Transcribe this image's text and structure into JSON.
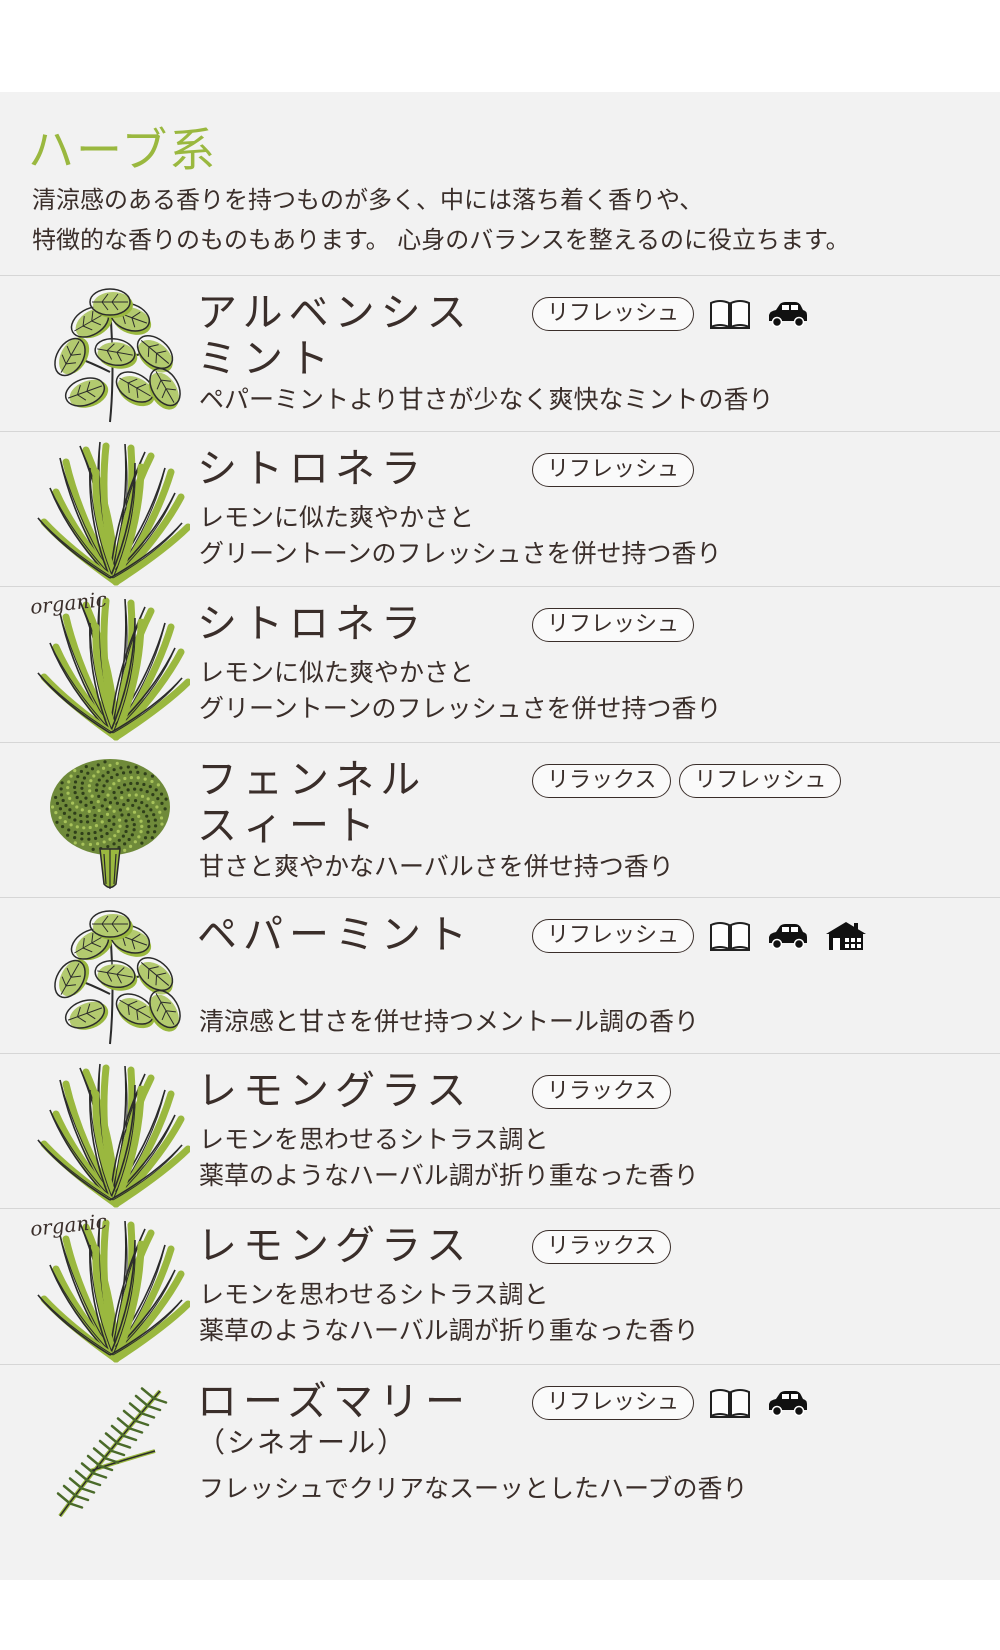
{
  "section": {
    "title": "ハーブ系",
    "description_line1": "清涼感のある香りを持つものが多く、中には落ち着く香りや、",
    "description_line2": "特徴的な香りのものもあります。 心身のバランスを整えるのに役立ちます。"
  },
  "colors": {
    "accent": "#9ab83f",
    "text": "#3a2e2a",
    "panel": "#f2f2f2"
  },
  "items": [
    {
      "name": "アルベンシス\nミント",
      "description": "ペパーミントより甘さが少なく爽快なミントの香り",
      "tags": [
        "リフレッシュ"
      ],
      "icons": [
        "book-icon",
        "car-icon"
      ],
      "organic": "",
      "image": "mint-illustration"
    },
    {
      "name": "シトロネラ",
      "description": "レモンに似た爽やかさと\nグリーントーンのフレッシュさを併せ持つ香り",
      "tags": [
        "リフレッシュ"
      ],
      "icons": [],
      "organic": "",
      "image": "grass-illustration"
    },
    {
      "name": "シトロネラ",
      "description": "レモンに似た爽やかさと\nグリーントーンのフレッシュさを併せ持つ香り",
      "tags": [
        "リフレッシュ"
      ],
      "icons": [],
      "organic": "organic",
      "image": "grass-illustration"
    },
    {
      "name": "フェンネル\nスィート",
      "description": "甘さと爽やかなハーバルさを併せ持つ香り",
      "tags": [
        "リラックス",
        "リフレッシュ"
      ],
      "icons": [],
      "organic": "",
      "image": "fennel-illustration"
    },
    {
      "name": "ペパーミント",
      "description": "清涼感と甘さを併せ持つメントール調の香り",
      "tags": [
        "リフレッシュ"
      ],
      "icons": [
        "book-icon",
        "car-icon",
        "house-icon"
      ],
      "organic": "",
      "image": "mint-illustration"
    },
    {
      "name": "レモングラス",
      "description": "レモンを思わせるシトラス調と\n薬草のようなハーバル調が折り重なった香り",
      "tags": [
        "リラックス"
      ],
      "icons": [],
      "organic": "",
      "image": "grass-illustration"
    },
    {
      "name": "レモングラス",
      "description": "レモンを思わせるシトラス調と\n薬草のようなハーバル調が折り重なった香り",
      "tags": [
        "リラックス"
      ],
      "icons": [],
      "organic": "organic",
      "image": "grass-illustration"
    },
    {
      "name": "ローズマリー",
      "subname": "（シネオール）",
      "description": "フレッシュでクリアなスーッとしたハーブの香り",
      "tags": [
        "リフレッシュ"
      ],
      "icons": [
        "book-icon",
        "car-icon"
      ],
      "organic": "",
      "image": "rosemary-illustration"
    }
  ]
}
